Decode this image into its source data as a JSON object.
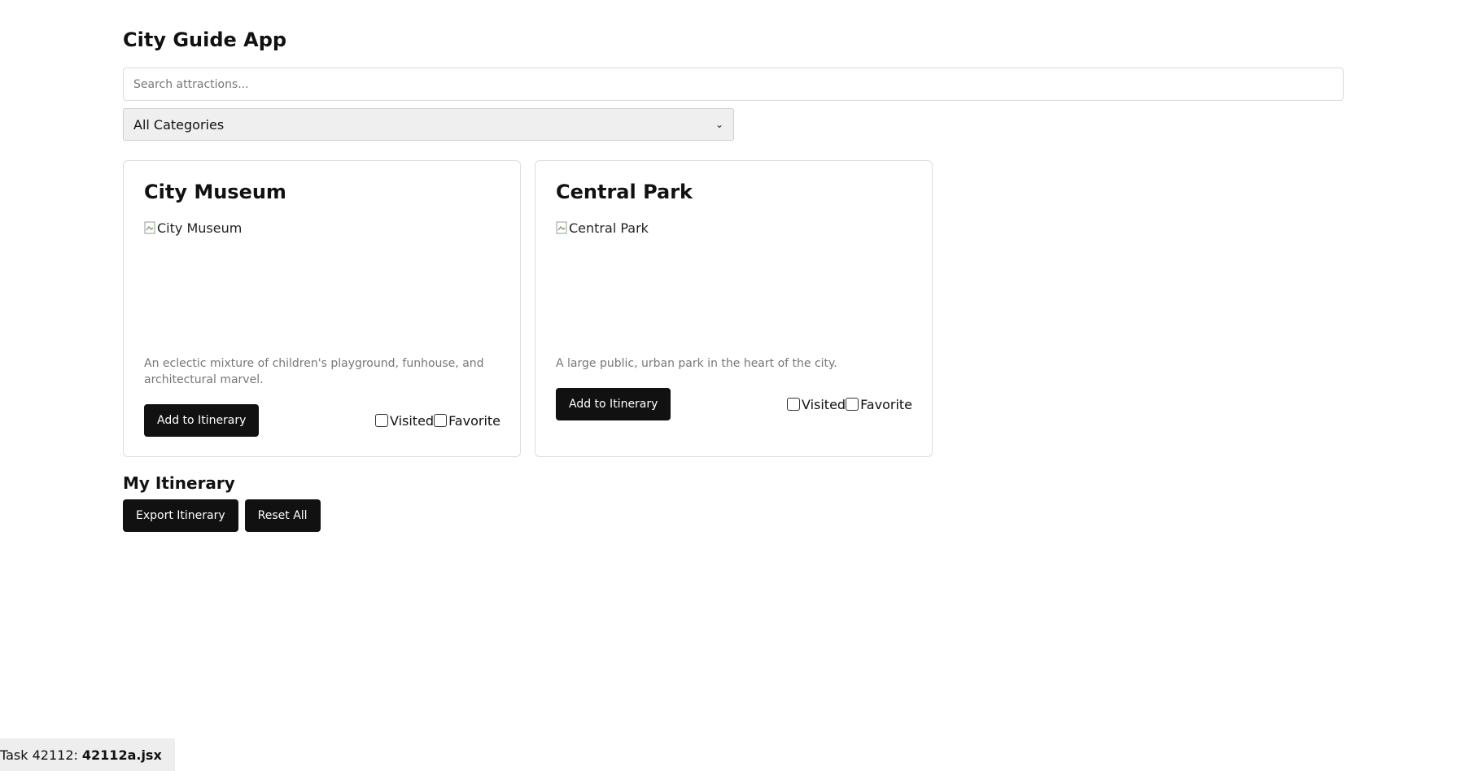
{
  "app": {
    "title": "City Guide App"
  },
  "search": {
    "placeholder": "Search attractions..."
  },
  "filter": {
    "selected": "All Categories"
  },
  "attractions": [
    {
      "name": "City Museum",
      "image_alt": "City Museum",
      "description": "An eclectic mixture of children's playground, funhouse, and architectural marvel.",
      "add_label": "Add to Itinerary",
      "visited_label": "Visited",
      "favorite_label": "Favorite",
      "visited": false,
      "favorite": false
    },
    {
      "name": "Central Park",
      "image_alt": "Central Park",
      "description": "A large public, urban park in the heart of the city.",
      "add_label": "Add to Itinerary",
      "visited_label": "Visited",
      "favorite_label": "Favorite",
      "visited": false,
      "favorite": false
    }
  ],
  "itinerary": {
    "title": "My Itinerary",
    "export_label": "Export Itinerary",
    "reset_label": "Reset All"
  },
  "task": {
    "prefix": "Task 42112:",
    "file": "42112a.jsx"
  }
}
